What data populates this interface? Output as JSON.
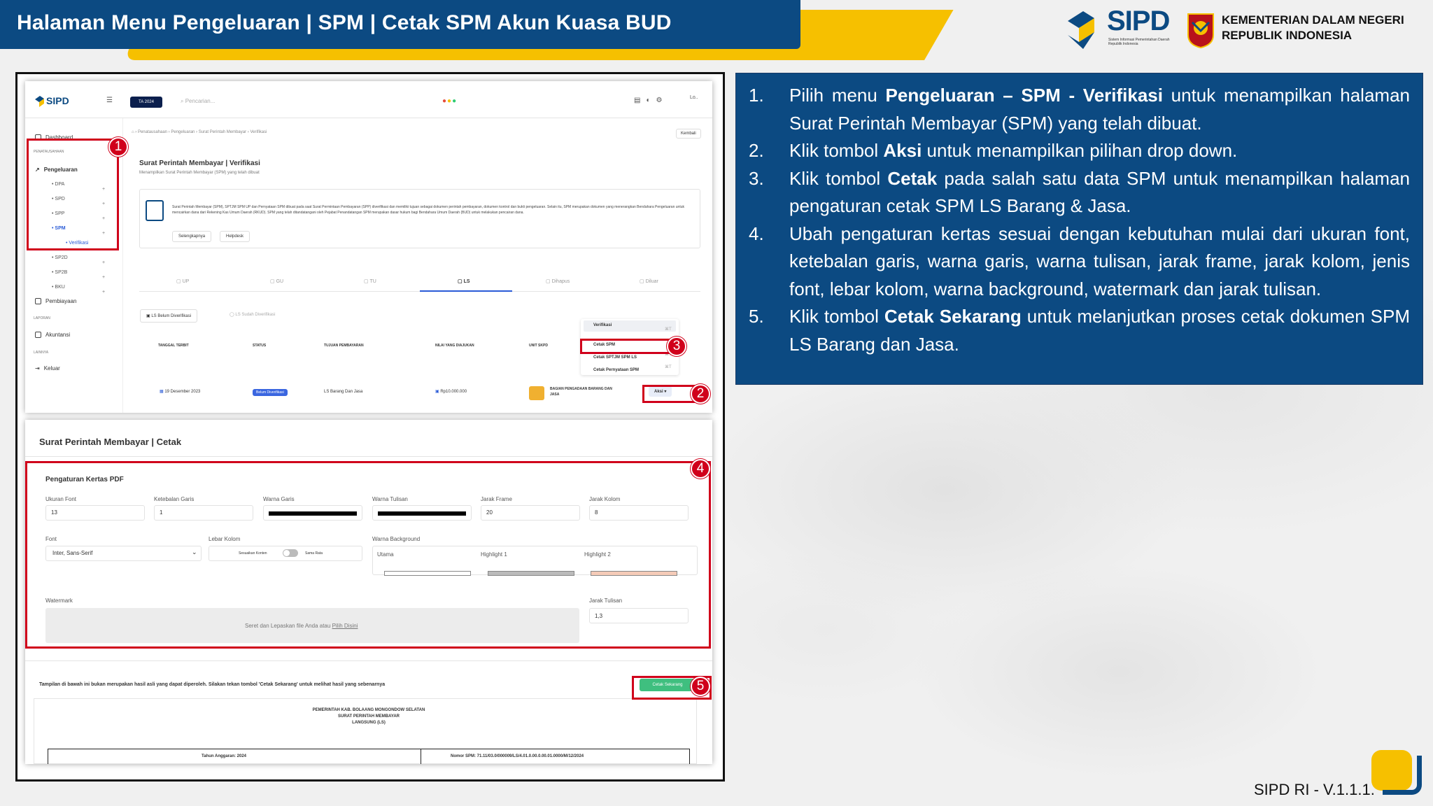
{
  "header": {
    "title": "Halaman Menu Pengeluaran | SPM | Cetak SPM Akun Kuasa BUD",
    "brand": "SIPD",
    "brand_sub": "Sistem Informasi Pemerintahan Daerah Republik Indonesia",
    "ministry_line1": "KEMENTERIAN DALAM NEGERI",
    "ministry_line2": "REPUBLIK INDONESIA",
    "accent": "#f6c000",
    "primary": "#0c4a82"
  },
  "app": {
    "logo": "SIPD",
    "year_badge": "TA 2024",
    "search_placeholder": "Pencarian...",
    "avatar_alt": "Lo..",
    "sidebar": {
      "dashboard": "Dashboard",
      "section_penatausahaan": "PENATAUSAHAAN",
      "pengeluaran": "Pengeluaran",
      "sub": [
        "DPA",
        "SPD",
        "SPP",
        "SPM",
        "Verifikasi",
        "SP2D",
        "SP2B",
        "BKU"
      ],
      "pembiayaan": "Pembiayaan",
      "section_laporan": "LAPORAN",
      "akuntansi": "Akuntansi",
      "section_lainnya": "LAINNYA",
      "keluar": "Keluar"
    },
    "breadcrumb": [
      "Penatausahaan",
      "Pengeluaran",
      "Surat Perintah Membayar",
      "Verifikasi"
    ],
    "back": "Kembali",
    "page_title": "Surat Perintah Membayar | Verifikasi",
    "page_sub": "Menampilkan Surat Perintah Membayar (SPM) yang telah dibuat",
    "info_text": "Surat Perintah Membayar (SPM), SPTJM SPM UP dan Pernyataan SPM dibuat pada saat Surat Permintaan Pembayaran (SPP) diverifikasi dan memiliki tujuan sebagai dokumen perintah pembayaran, dokumen kontrol dan bukti pengeluaran. Selain itu, SPM merupakan dokumen yang menerangkan Bendahara Pengeluaran untuk mencairkan dana dari Rekening Kas Umum Daerah (RKUD). SPM yang telah ditandatangani oleh Pejabat Penandatangan SPM merupakan dasar hukum bagi Bendahara Umum Daerah (BUD) untuk melakukan pencairan dana.",
    "info_btn1": "Selengkapnya",
    "info_btn2": "Helpdesk",
    "tabs": [
      "UP",
      "GU",
      "TU",
      "LS",
      "Dihapus",
      "Diluar"
    ],
    "subtabs": [
      "LS Belum Diverifikasi",
      "LS Sudah Diverifikasi"
    ],
    "columns": [
      "TANGGAL TERBIT",
      "STATUS",
      "TUJUAN PEMBAYARAN",
      "NILAI YANG DIAJUKAN",
      "UNIT SKPD"
    ],
    "row": {
      "date": "19 Desember 2023",
      "status": "Belum Diverifikasi",
      "tujuan": "LS Barang Dan Jasa",
      "nilai": "Rp10.000.000",
      "unit": "BAGIAN PENGADAAN BARANG DAN JASA",
      "aksi": "Aksi"
    },
    "dropdown": {
      "verifikasi": "Verifikasi",
      "cetak_spm": "Cetak SPM",
      "cetak_sptjm": "Cetak SPTJM SPM LS",
      "cetak_pernyataan": "Cetak Pernyataan SPM"
    },
    "print": {
      "title": "Surat Perintah Membayar | Cetak",
      "section": "Pengaturan Kertas PDF",
      "ukuran_font_label": "Ukuran Font",
      "ukuran_font": "13",
      "ketebalan_label": "Ketebalan Garis",
      "ketebalan": "1",
      "warna_garis_label": "Warna Garis",
      "warna_tulisan_label": "Warna Tulisan",
      "jarak_frame_label": "Jarak Frame",
      "jarak_frame": "20",
      "jarak_kolom_label": "Jarak Kolom",
      "jarak_kolom": "8",
      "font_label": "Font",
      "font": "Inter, Sans-Serif",
      "lebar_kolom_label": "Lebar Kolom",
      "toggle_left": "Sesuaikan Konten",
      "toggle_right": "Sama Rata",
      "bg_label": "Warna Background",
      "bg_utama": "Utama",
      "bg_h1": "Highlight 1",
      "bg_h2": "Highlight 2",
      "watermark_label": "Watermark",
      "dropzone": "Seret dan Lepaskan file Anda atau",
      "dropzone_link": "Pilih Disini",
      "jarak_tulisan_label": "Jarak Tulisan",
      "jarak_tulisan": "1,3",
      "notice": "Tampilan di bawah ini bukan merupakan hasil asli yang dapat diperoleh. Silakan tekan tombol 'Cetak Sekarang' untuk melihat hasil yang sebenarnya",
      "cetak_btn": "Cetak Sekarang",
      "doc1": "PEMERINTAH KAB. BOLAANG MONGONDOW SELATAN",
      "doc2": "SURAT PERINTAH MEMBAYAR",
      "doc3": "LANGSUNG (LS)",
      "doc_tahun": "Tahun Anggaran: 2024",
      "doc_nomor": "Nomor SPM: 71.11/03.0/000009/LS/4.01.0.00.0.00.01.0000/M/12/2024"
    }
  },
  "badges": [
    "1",
    "2",
    "3",
    "4",
    "5"
  ],
  "steps": [
    {
      "num": "1.",
      "pre": "Pilih menu ",
      "bold": "Pengeluaran – SPM - Verifikasi",
      "post": " untuk menampilkan halaman Surat Perintah Membayar (SPM) yang telah dibuat."
    },
    {
      "num": "2.",
      "pre": "Klik tombol ",
      "bold": "Aksi",
      "post": " untuk menampilkan pilihan drop down."
    },
    {
      "num": "3.",
      "pre": "Klik tombol ",
      "bold": "Cetak",
      "post": " pada salah satu data SPM untuk menampilkan halaman pengaturan cetak SPM LS Barang & Jasa."
    },
    {
      "num": "4.",
      "pre": "Ubah pengaturan kertas sesuai dengan kebutuhan mulai dari ukuran font, ketebalan garis, warna garis, warna tulisan, jarak frame, jarak kolom, jenis font, lebar kolom, warna background, watermark dan jarak tulisan.",
      "bold": "",
      "post": ""
    },
    {
      "num": "5.",
      "pre": "Klik tombol ",
      "bold": "Cetak Sekarang",
      "post": " untuk melanjutkan proses cetak dokumen SPM LS Barang dan Jasa."
    }
  ],
  "footer": {
    "version": "SIPD RI - V.1.1.1."
  }
}
